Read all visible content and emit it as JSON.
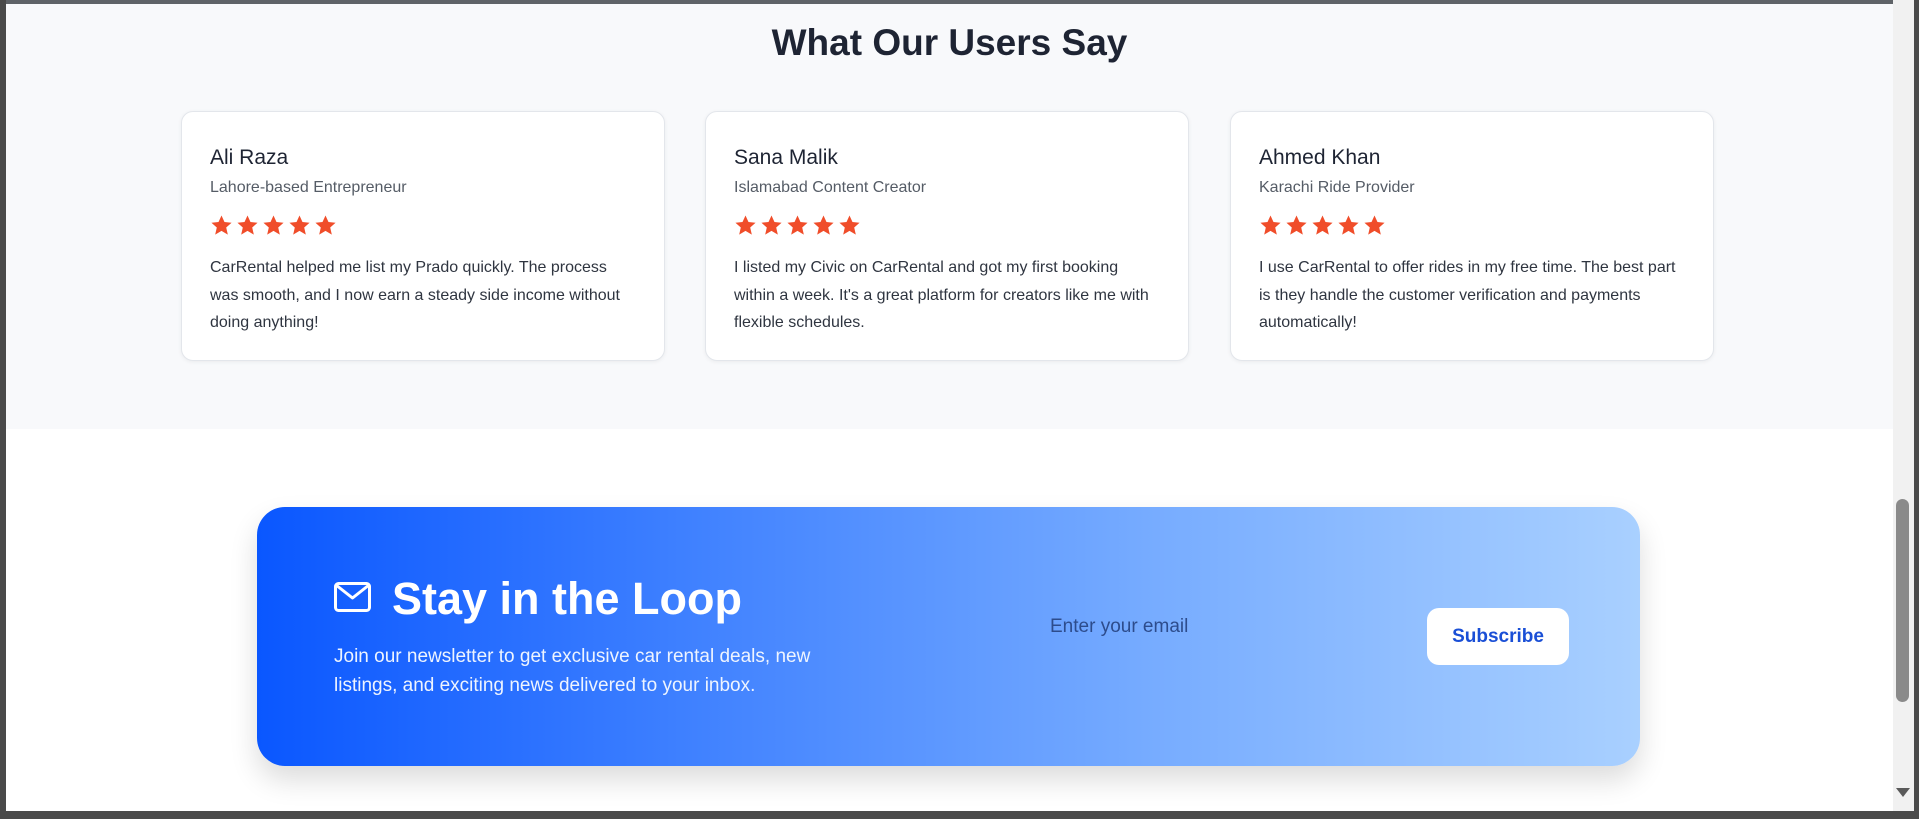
{
  "testimonials": {
    "title": "What Our Users Say",
    "star_color": "#f04d2a",
    "cards": [
      {
        "name": "Ali Raza",
        "role": "Lahore-based Entrepreneur",
        "rating": 5,
        "text": "CarRental helped me list my Prado quickly. The process was smooth, and I now earn a steady side income without doing anything!"
      },
      {
        "name": "Sana Malik",
        "role": "Islamabad Content Creator",
        "rating": 5,
        "text": "I listed my Civic on CarRental and got my first booking within a week. It's a great platform for creators like me with flexible schedules."
      },
      {
        "name": "Ahmed Khan",
        "role": "Karachi Ride Provider",
        "rating": 5,
        "text": "I use CarRental to offer rides in my free time. The best part is they handle the customer verification and payments automatically!"
      }
    ]
  },
  "newsletter": {
    "icon": "mail-icon",
    "title": "Stay in the Loop",
    "description": "Join our newsletter to get exclusive car rental deals, new listings, and exciting news delivered to your inbox.",
    "email_placeholder": "Enter your email",
    "email_value": "",
    "subscribe_label": "Subscribe",
    "gradient_start": "#0a57ff",
    "gradient_end": "#a9d0ff"
  }
}
